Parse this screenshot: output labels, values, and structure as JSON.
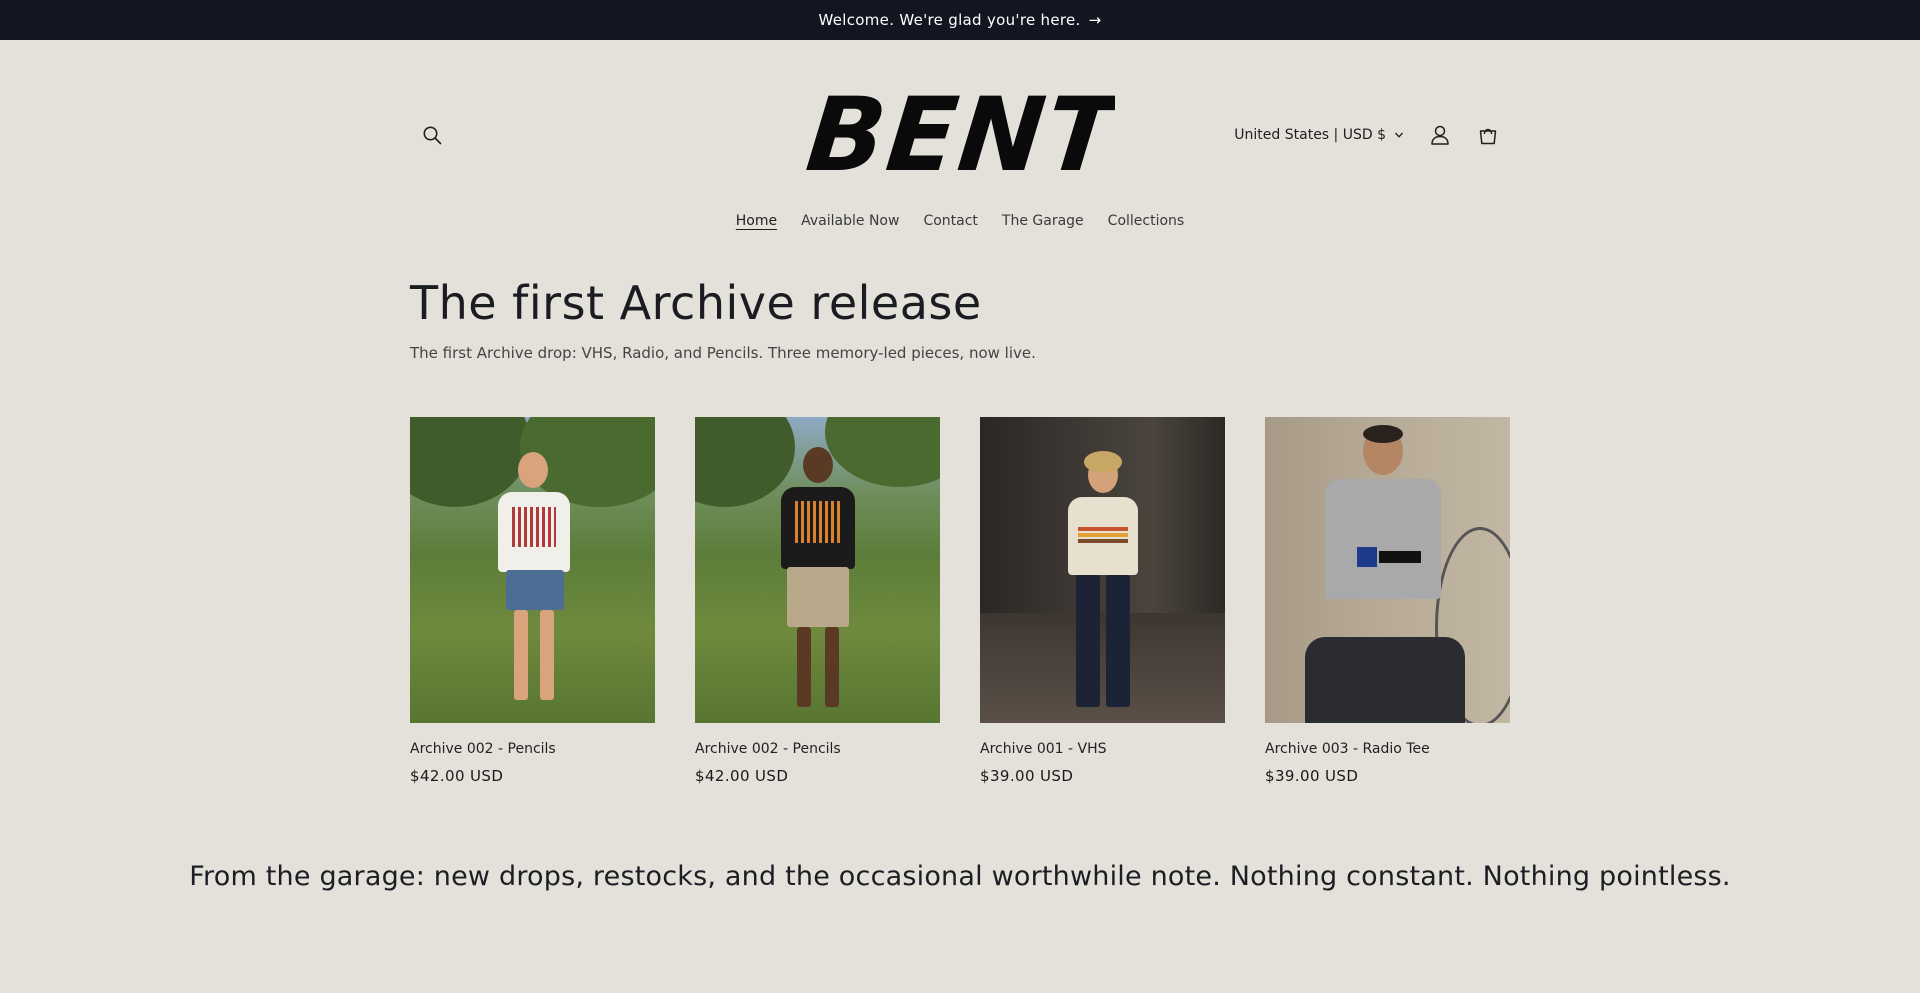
{
  "announcement": {
    "text": "Welcome. We're glad you're here.",
    "arrow": "→"
  },
  "header": {
    "logo_text": "BENT",
    "country_label": "United States | USD $",
    "icons": [
      "search-icon",
      "account-icon",
      "cart-icon",
      "chevron-down-icon"
    ]
  },
  "nav": {
    "items": [
      {
        "label": "Home",
        "active": true
      },
      {
        "label": "Available Now",
        "active": false
      },
      {
        "label": "Contact",
        "active": false
      },
      {
        "label": "The Garage",
        "active": false
      },
      {
        "label": "Collections",
        "active": false
      }
    ]
  },
  "hero": {
    "title": "The first Archive release",
    "subtitle": "The first Archive drop: VHS, Radio, and Pencils. Three memory-led pieces, now live."
  },
  "products": [
    {
      "name": "Archive 002 - Pencils",
      "price": "$42.00 USD"
    },
    {
      "name": "Archive 002 - Pencils",
      "price": "$42.00 USD"
    },
    {
      "name": "Archive 001 - VHS",
      "price": "$39.00 USD"
    },
    {
      "name": "Archive 003 - Radio Tee",
      "price": "$39.00 USD"
    }
  ],
  "garage_note": "From the garage: new drops, restocks, and the occasional worthwhile note. Nothing constant. Nothing pointless.",
  "colors": {
    "announcement_bg": "#121620",
    "page_bg": "#e3e1da",
    "text": "#1f1f1f"
  }
}
